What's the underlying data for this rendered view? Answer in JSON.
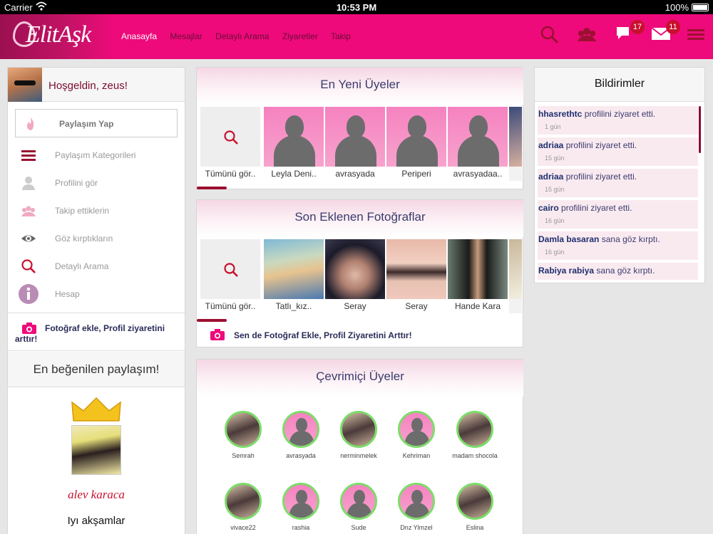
{
  "statusbar": {
    "carrier": "Carrier",
    "time": "10:53 PM",
    "battery": "100%"
  },
  "brand": {
    "logo": "ElitAşk"
  },
  "nav": {
    "links": [
      "Anasayfa",
      "Mesajlar",
      "Detaylı Arama",
      "Ziyaretler",
      "Takip"
    ],
    "active": "Anasayfa",
    "notifications_count": "17",
    "messages_count": "11",
    "icons": [
      "search-icon",
      "users-icon",
      "chat-icon",
      "mail-icon",
      "menu-icon"
    ]
  },
  "sidebar": {
    "welcome": "Hoşgeldin, zeus!",
    "items": [
      {
        "label": "Paylaşım Yap",
        "icon": "flame-icon"
      },
      {
        "label": "Paylaşım Kategorileri",
        "icon": "list-icon"
      },
      {
        "label": "Profilini gör",
        "icon": "user-icon"
      },
      {
        "label": "Takip ettiklerin",
        "icon": "followers-icon"
      },
      {
        "label": "Göz kırptıkların",
        "icon": "eye-icon"
      },
      {
        "label": "Detaylı Arama",
        "icon": "search-icon"
      },
      {
        "label": "Hesap",
        "icon": "info-icon"
      }
    ],
    "photo_promo": "Fotoğraf ekle, Profil ziyaretini arttır!",
    "liked_title": "En beğenilen paylaşım!",
    "liked_name": "alev karaca",
    "liked_caption": "Iyı akşamlar"
  },
  "newest": {
    "title": "En Yeni Üyeler",
    "see_all": "Tümünü gör..",
    "members": [
      "Leyla Deni..",
      "avrasyada",
      "Periperi",
      "avrasyadaa.."
    ]
  },
  "photos": {
    "title": "Son Eklenen Fotoğraflar",
    "see_all": "Tümünü gör..",
    "items": [
      "Tatlı_kız..",
      "Seray",
      "Seray",
      "Hande Kara"
    ],
    "promo": "Sen de Fotoğraf Ekle, Profil Ziyaretini Arttır!"
  },
  "online": {
    "title": "Çevrimiçi Üyeler",
    "row1": [
      "Semrah",
      "avrasyada",
      "nerminmelek",
      "Kehriman",
      "madam shocola"
    ],
    "row2": [
      "vivace22",
      "rashia",
      "Sude",
      "Dnz Ylmzel",
      "Eslina"
    ]
  },
  "notifications": {
    "title": "Bildirimler",
    "items": [
      {
        "user": "hhasrethtc",
        "action": "profilini ziyaret etti.",
        "when": "1 gün"
      },
      {
        "user": "adriaa",
        "action": "profilini ziyaret etti.",
        "when": "15 gün"
      },
      {
        "user": "adriaa",
        "action": "profilini ziyaret etti.",
        "when": "15 gün"
      },
      {
        "user": "cairo",
        "action": "profilini ziyaret etti.",
        "when": "16 gün"
      },
      {
        "user": "Damla basaran",
        "action": "sana göz kırptı.",
        "when": "16 gün"
      },
      {
        "user": "Rabiya rabiya",
        "action": "sana göz kırptı.",
        "when": ""
      }
    ]
  },
  "colors": {
    "brand": "#ee0a7a",
    "dark_brand": "#9b1030",
    "online_ring": "#7ddc6a"
  }
}
